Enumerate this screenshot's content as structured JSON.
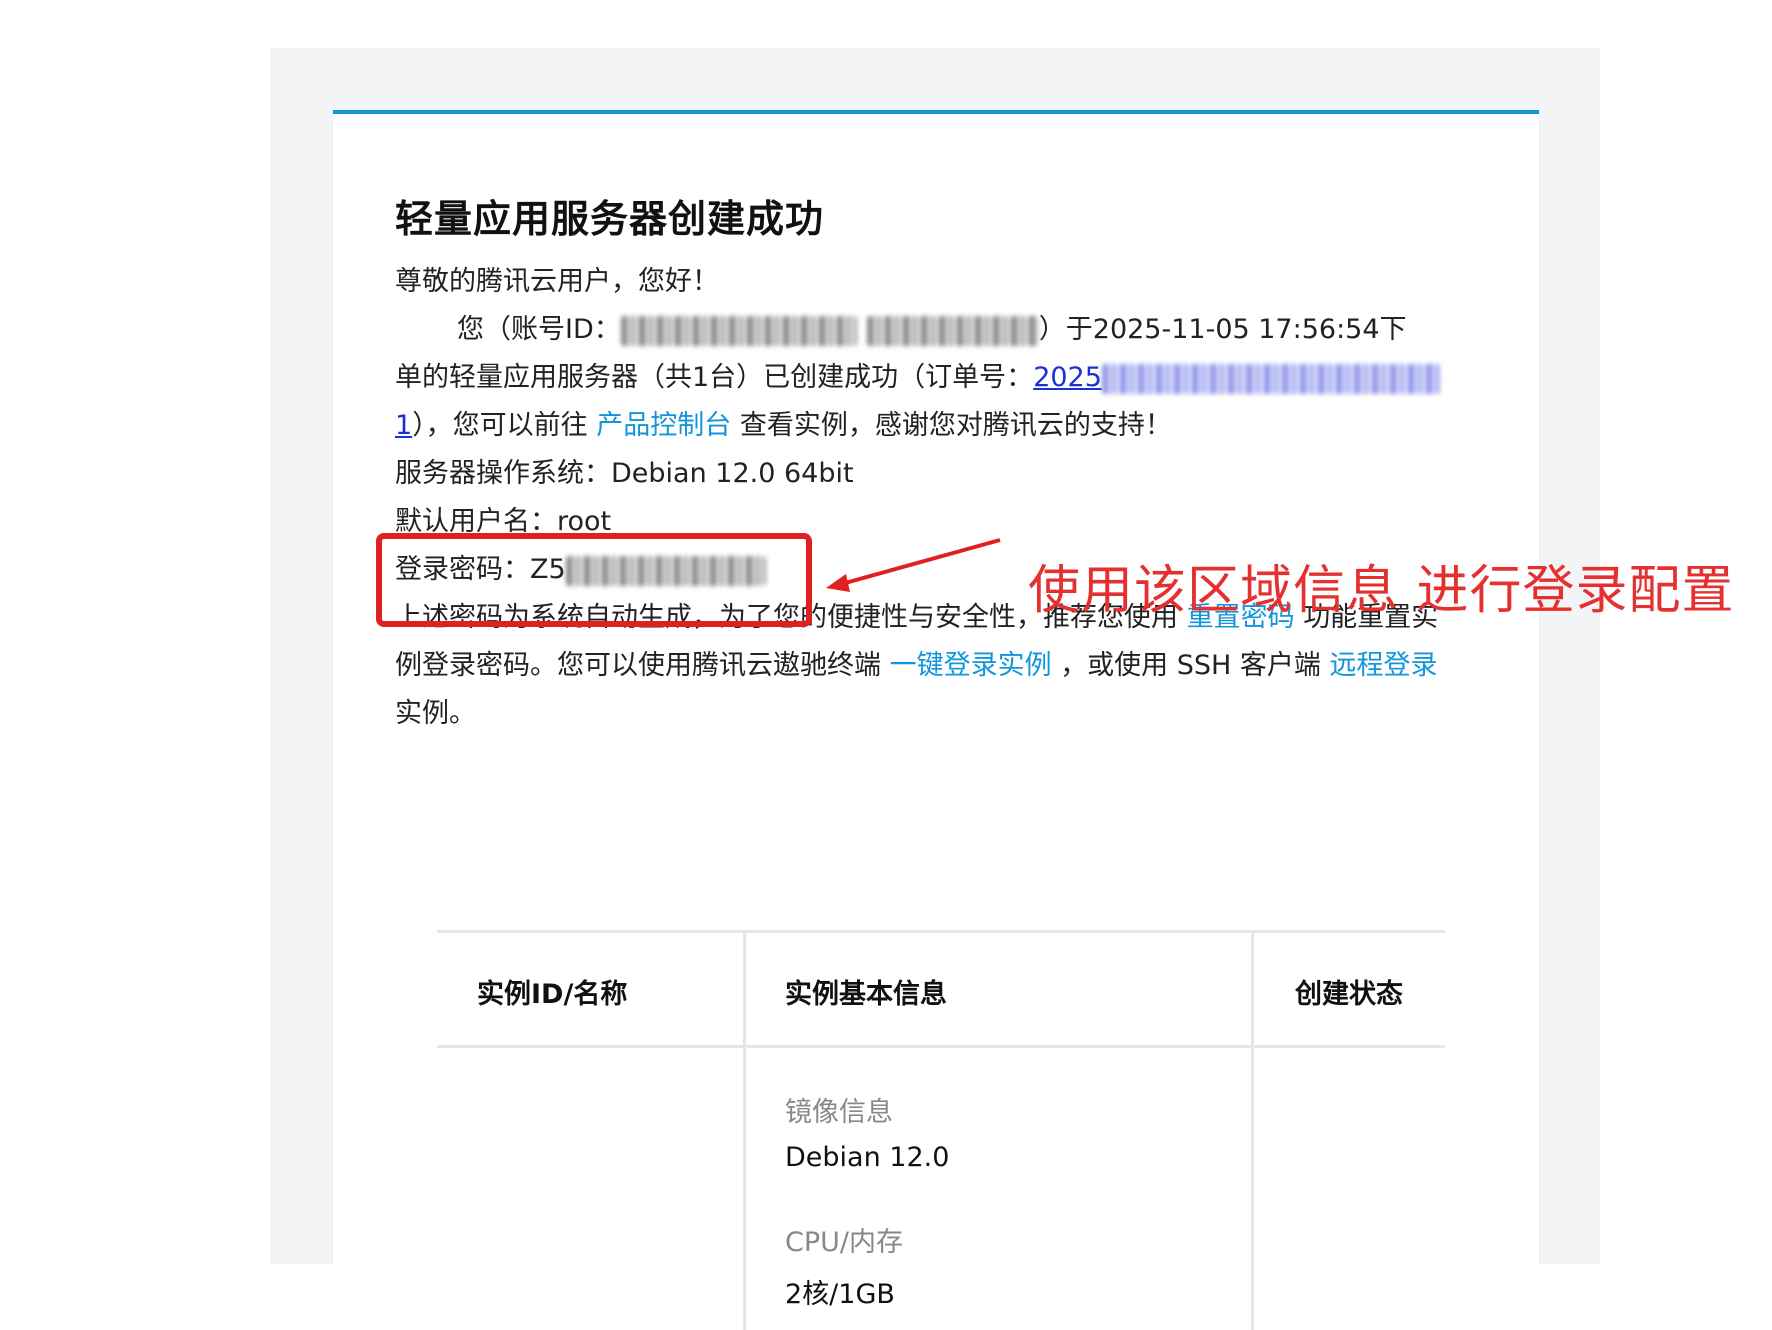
{
  "email": {
    "title": "轻量应用服务器创建成功",
    "greeting": "尊敬的腾讯云用户，您好！",
    "line1_prefix": "您（账号ID：",
    "line1_suffix": "）于2025-11-05 17:56:54下",
    "line2_prefix": "单的轻量应用服务器（共1台）已创建成功（订单号：",
    "order_visible_start": "2025",
    "order_visible_end": "1",
    "line3_mid": "），您可以前往",
    "console_link": "产品控制台",
    "line3_suffix": "查看实例，感谢您对腾讯云的支持！",
    "os_line": "服务器操作系统：Debian 12.0 64bit",
    "user_line": "默认用户名：root",
    "password_prefix": "登录密码：Z5",
    "para_prefix": "上述密码为系统自动生成，为了您的便捷性与安全性，推荐您使用",
    "reset_link": "重置密码",
    "para_mid1": "功能重置实",
    "para_line2_prefix": "例登录密码。您可以使用腾讯云遨驰终端",
    "oneclick_link": "一键登录实例",
    "para_mid2": "，或使用 SSH 客户端",
    "remote_link": "远程登录",
    "para_end": "实例。"
  },
  "annotation": {
    "text": "使用该区域信息 进行登录配置",
    "color": "#e53030"
  },
  "table": {
    "headers": [
      "实例ID/名称",
      "实例基本信息",
      "创建状态"
    ],
    "info": [
      {
        "label": "镜像信息",
        "value": "Debian 12.0"
      },
      {
        "label": "CPU/内存",
        "value": "2核/1GB"
      }
    ]
  },
  "colors": {
    "accent": "#1296db",
    "link": "#1a2fd6",
    "highlight": "#e02020"
  }
}
